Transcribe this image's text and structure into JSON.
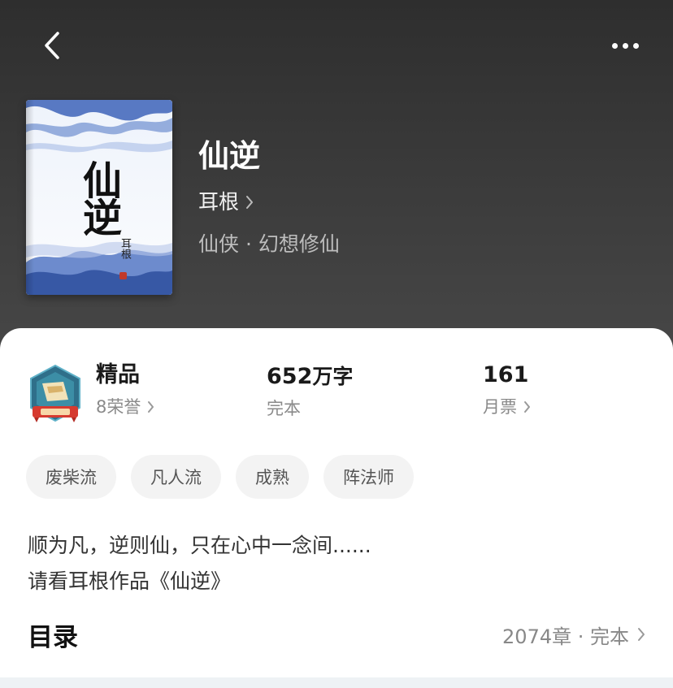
{
  "nav": {
    "back_icon": "chevron-left-icon",
    "more_icon": "more-horizontal-icon"
  },
  "book": {
    "cover": {
      "title": "仙逆",
      "author": "耳根",
      "accent_color": "#3d63b8"
    },
    "title": "仙逆",
    "author": "耳根",
    "genre": "仙侠 · 幻想修仙"
  },
  "stats": {
    "honor": {
      "badge": "精品",
      "label": "8荣誉"
    },
    "words": {
      "value": "652",
      "unit": "万字",
      "label": "完本"
    },
    "tickets": {
      "value": "161",
      "label": "月票"
    }
  },
  "tags": [
    "废柴流",
    "凡人流",
    "成熟",
    "阵法师"
  ],
  "intro": {
    "line1": "顺为凡，逆则仙，只在心中一念间......",
    "line2": "请看耳根作品《仙逆》"
  },
  "toc": {
    "title": "目录",
    "meta": "2074章 · 完本"
  },
  "colors": {
    "header_bg": "#3a3a3a",
    "panel_bg": "#ffffff",
    "tag_bg": "#f3f3f3",
    "muted_text": "#8a8a8a"
  }
}
